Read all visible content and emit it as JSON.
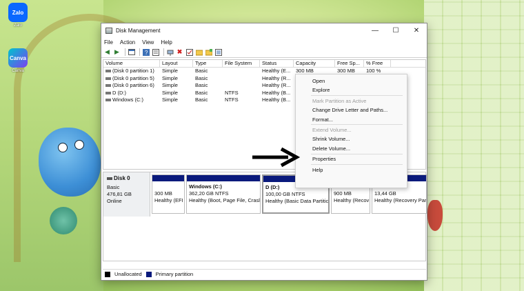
{
  "desktop": {
    "icons": [
      {
        "name": "Zalo",
        "tile": "Zalo",
        "color": "#0a68ff"
      },
      {
        "name": "Canva",
        "tile": "Canva",
        "color": "#7b3ff2"
      }
    ]
  },
  "window": {
    "title": "Disk Management",
    "controls": {
      "minimize": "—",
      "maximize": "☐",
      "close": "✕"
    },
    "menu": [
      "File",
      "Action",
      "View",
      "Help"
    ]
  },
  "volume_table": {
    "columns": [
      "Volume",
      "Layout",
      "Type",
      "File System",
      "Status",
      "Capacity",
      "Free Sp...",
      "% Free"
    ],
    "rows": [
      [
        "(Disk 0 partition 1)",
        "Simple",
        "Basic",
        "",
        "Healthy (E...",
        "300 MB",
        "300 MB",
        "100 %"
      ],
      [
        "(Disk 0 partition 5)",
        "Simple",
        "Basic",
        "",
        "Healthy (R...",
        "9",
        "",
        ""
      ],
      [
        "(Disk 0 partition 6)",
        "Simple",
        "Basic",
        "",
        "Healthy (R...",
        "1",
        "",
        ""
      ],
      [
        "D (D:)",
        "Simple",
        "Basic",
        "NTFS",
        "Healthy (B...",
        "1",
        "",
        ""
      ],
      [
        "Windows (C:)",
        "Simple",
        "Basic",
        "NTFS",
        "Healthy (B...",
        "3",
        "",
        ""
      ]
    ]
  },
  "disk": {
    "name": "Disk 0",
    "type": "Basic",
    "size": "476,81 GB",
    "status": "Online",
    "partitions": [
      {
        "title": "",
        "size": "300 MB",
        "status": "Healthy (EFI"
      },
      {
        "title": "Windows  (C:)",
        "size": "362,20 GB NTFS",
        "status": "Healthy (Boot, Page File, Crasl"
      },
      {
        "title": "D  (D:)",
        "size": "100,00 GB NTFS",
        "status": "Healthy (Basic Data Partitic"
      },
      {
        "title": "",
        "size": "900 MB",
        "status": "Healthy (Recov"
      },
      {
        "title": "",
        "size": "13,44 GB",
        "status": "Healthy (Recovery Par"
      }
    ]
  },
  "legend": {
    "unallocated": "Unallocated",
    "primary": "Primary partition",
    "unallocated_color": "#000000",
    "primary_color": "#0a1a7c"
  },
  "context_menu": {
    "items": [
      {
        "label": "Open",
        "enabled": true
      },
      {
        "label": "Explore",
        "enabled": true
      },
      {
        "label": "Mark Partition as Active",
        "enabled": false
      },
      {
        "label": "Change Drive Letter and Paths...",
        "enabled": true
      },
      {
        "label": "Format...",
        "enabled": true
      },
      {
        "label": "Extend Volume...",
        "enabled": false
      },
      {
        "label": "Shrink Volume...",
        "enabled": true
      },
      {
        "label": "Delete Volume...",
        "enabled": true
      },
      {
        "label": "Properties",
        "enabled": true
      },
      {
        "label": "Help",
        "enabled": true
      }
    ]
  },
  "toolbar_icons": [
    "back-arrow-icon",
    "forward-arrow-icon",
    "console-tree-icon",
    "help-icon",
    "properties-icon",
    "connect-icon",
    "delete-icon",
    "checklist-icon",
    "folder-icon",
    "new-folder-icon",
    "list-view-icon"
  ]
}
